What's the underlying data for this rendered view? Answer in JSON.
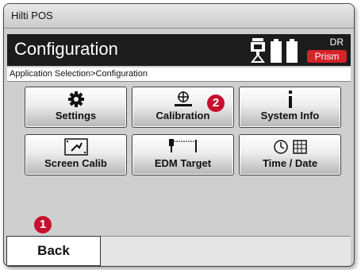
{
  "window": {
    "title": "Hilti POS"
  },
  "header": {
    "title": "Configuration",
    "status": {
      "mode": "DR",
      "target": "Prism"
    },
    "icons": [
      "instrument-icon",
      "battery-icon",
      "battery-icon"
    ],
    "colors": {
      "header_bg": "#1c1c1c",
      "badge": "#d5232a"
    }
  },
  "breadcrumb": "Application Selection>Configuration",
  "buttons": [
    {
      "label": "Settings",
      "icon": "gear-icon"
    },
    {
      "label": "Calibration",
      "icon": "calibration-icon"
    },
    {
      "label": "System Info",
      "icon": "info-icon"
    },
    {
      "label": "Screen Calib",
      "icon": "screen-calibration-icon"
    },
    {
      "label": "EDM Target",
      "icon": "edm-target-icon"
    },
    {
      "label": "Time / Date",
      "icon": "clock-calendar-icon"
    }
  ],
  "markers": [
    "1",
    "2"
  ],
  "footer": {
    "back_label": "Back"
  }
}
